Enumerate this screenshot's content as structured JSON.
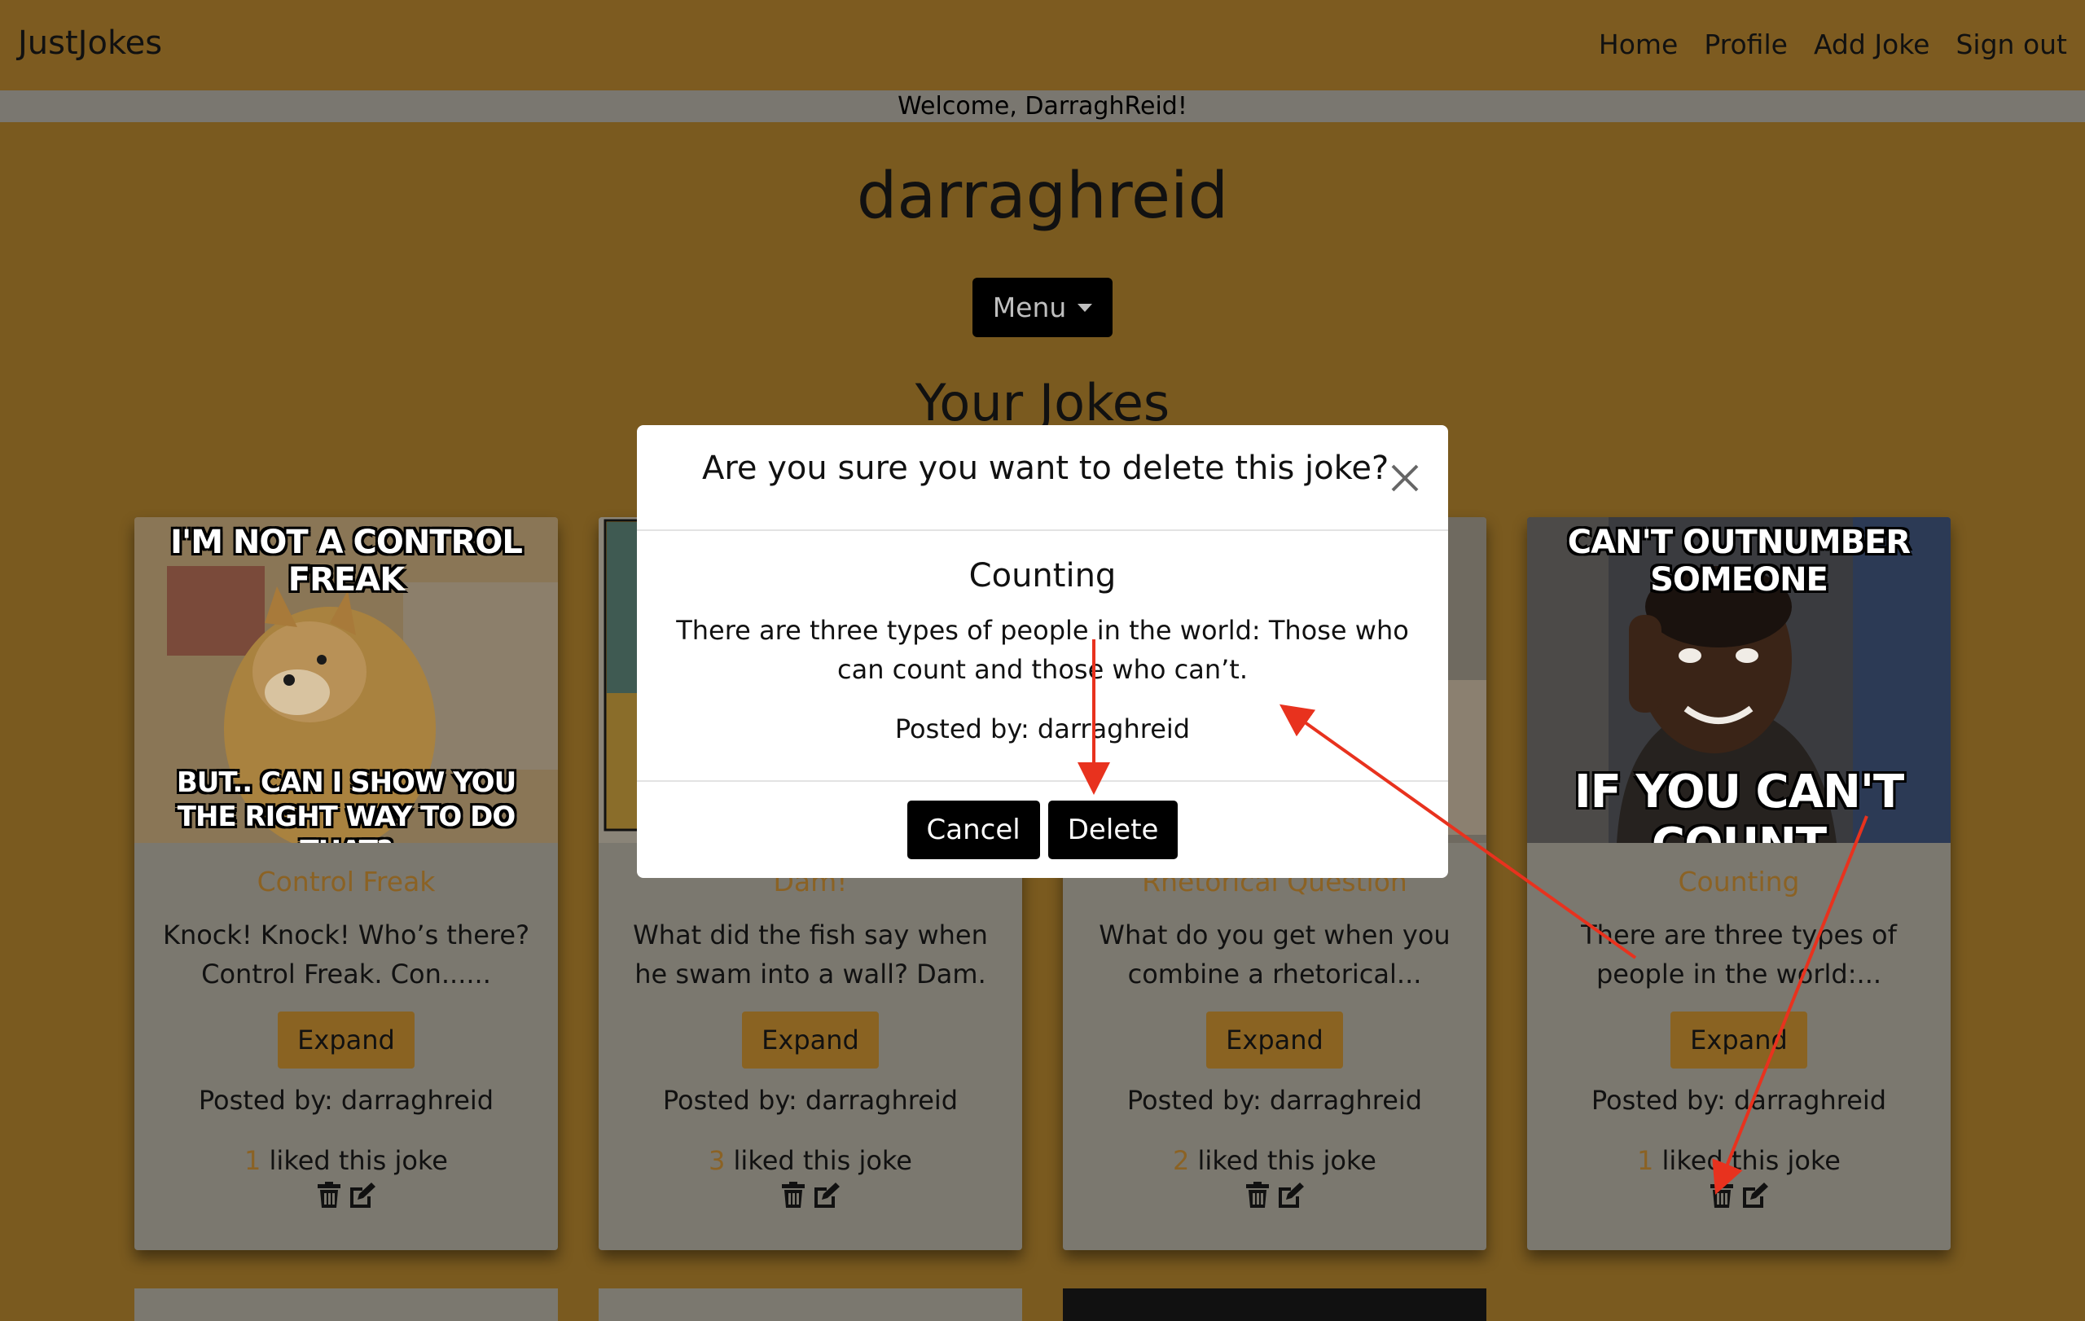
{
  "nav": {
    "brand": "JustJokes",
    "links": [
      "Home",
      "Profile",
      "Add Joke",
      "Sign out"
    ]
  },
  "welcome": "Welcome, DarraghReid!",
  "profile": {
    "username": "darraghreid",
    "menu_label": "Menu",
    "section_title": "Your Jokes"
  },
  "cards": [
    {
      "title": "Control Freak",
      "excerpt": "Knock! Knock! Who’s there? Control Freak. Con......",
      "expand": "Expand",
      "posted_by": "Posted by: darraghreid",
      "likes": "1",
      "likes_suffix": "liked this joke",
      "meme_top": "I'M NOT A CONTROL FREAK",
      "meme_bottom": "BUT.. CAN I SHOW YOU THE RIGHT WAY TO DO THAT?"
    },
    {
      "title": "Dam!",
      "excerpt": "What did the fish say when he swam into a wall? Dam.",
      "expand": "Expand",
      "posted_by": "Posted by: darraghreid",
      "likes": "3",
      "likes_suffix": "liked this joke"
    },
    {
      "title": "Rhetorical Question",
      "excerpt": "What do you get when you combine a rhetorical...",
      "expand": "Expand",
      "posted_by": "Posted by: darraghreid",
      "likes": "2",
      "likes_suffix": "liked this joke"
    },
    {
      "title": "Counting",
      "excerpt": "There are three types of people in the world:...",
      "expand": "Expand",
      "posted_by": "Posted by: darraghreid",
      "likes": "1",
      "likes_suffix": "liked this joke",
      "meme_top": "CAN'T OUTNUMBER SOMEONE",
      "meme_bottom": "IF YOU CAN'T COUNT"
    }
  ],
  "modal": {
    "title": "Are you sure you want to delete this joke?",
    "joke_title": "Counting",
    "joke_text": "There are three types of people in the world: Those who can count and those who can’t.",
    "posted_by": "Posted by: darraghreid",
    "cancel": "Cancel",
    "delete": "Delete"
  },
  "icons": {
    "close": "close-icon",
    "delete": "trash-icon",
    "edit": "edit-icon"
  },
  "colors": {
    "overlay_gold": "#7a5a1f",
    "accent": "#8b6224",
    "annotation": "#e8321e"
  }
}
